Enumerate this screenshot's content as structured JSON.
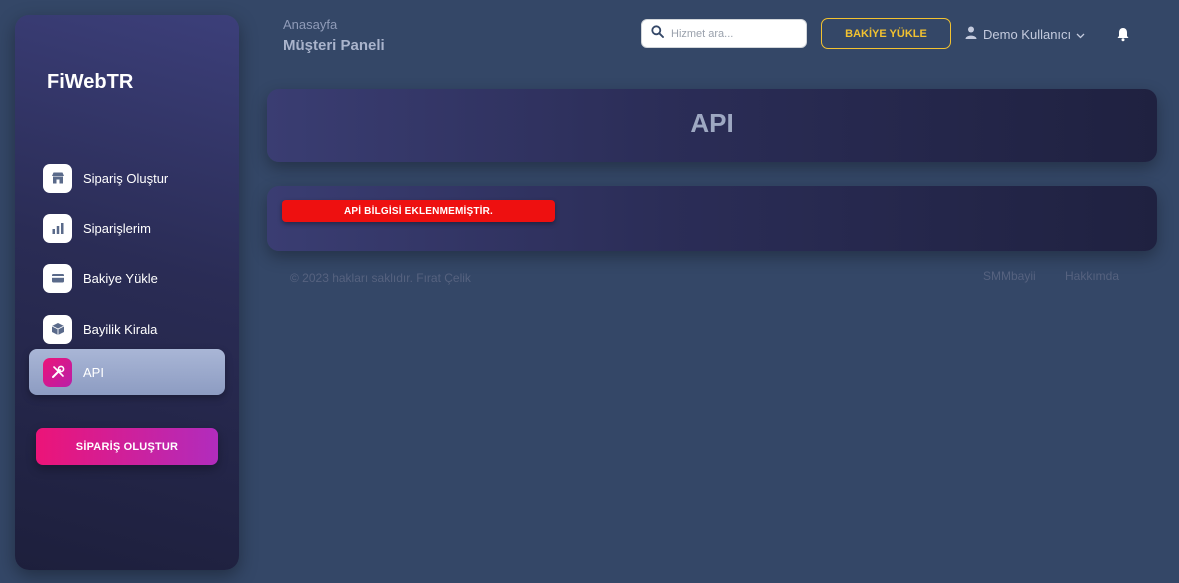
{
  "sidebar": {
    "brand": "FiWebTR",
    "items": [
      {
        "label": "Sipariş Oluştur",
        "icon": "shop-icon"
      },
      {
        "label": "Siparişlerim",
        "icon": "chart-icon"
      },
      {
        "label": "Bakiye Yükle",
        "icon": "credit-card-icon"
      },
      {
        "label": "Bayilik Kirala",
        "icon": "box-icon"
      },
      {
        "label": "API",
        "icon": "tools-icon",
        "active": true
      }
    ],
    "cta_label": "SİPARİŞ OLUŞTUR"
  },
  "header": {
    "breadcrumb": "Anasayfa",
    "title": "Müşteri Paneli",
    "search_placeholder": "Hizmet ara...",
    "topup_label": "BAKİYE YÜKLE",
    "user_name": "Demo Kullanıcı"
  },
  "main": {
    "title": "API",
    "alert": "APİ BİLGİSİ EKLENMEMİŞTİR."
  },
  "footer": {
    "copyright": "© 2023 hakları saklıdır. Fırat Çelik",
    "links": [
      "SMMbayii",
      "Hakkımda"
    ]
  },
  "colors": {
    "background": "#344767",
    "accent_pink": "#ec1478",
    "accent_yellow": "#f2c230",
    "alert_red": "#ee1010"
  }
}
